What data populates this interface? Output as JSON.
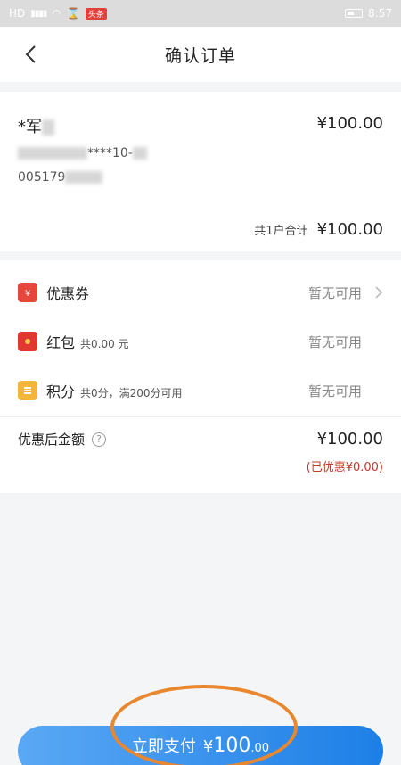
{
  "status_bar": {
    "left_text": "HD",
    "badge": "头条",
    "time": "8:57"
  },
  "header": {
    "title": "确认订单"
  },
  "order": {
    "name_prefix": "*军",
    "amount": "¥100.00",
    "line1_prefix": "",
    "line1_masked": "****10-",
    "line2_prefix": "005179",
    "total_label": "共1户合计",
    "total_amount": "¥100.00"
  },
  "discounts": {
    "coupon": {
      "label": "优惠券",
      "value": "暂无可用"
    },
    "red_packet": {
      "label": "红包",
      "sub": "共0.00 元",
      "value": "暂无可用"
    },
    "points": {
      "label": "积分",
      "sub": "共0分，满200分可用",
      "value": "暂无可用"
    }
  },
  "summary": {
    "label": "优惠后金额",
    "help": "?",
    "amount": "¥100.00",
    "saved": "(已优惠¥0.00)"
  },
  "pay_button": {
    "label": "立即支付",
    "currency": "¥",
    "amount_int": "100",
    "amount_dec": ".00"
  },
  "colors": {
    "accent": "#1d7fe6",
    "discount_red": "#c0392b",
    "highlight": "#e9872e"
  }
}
